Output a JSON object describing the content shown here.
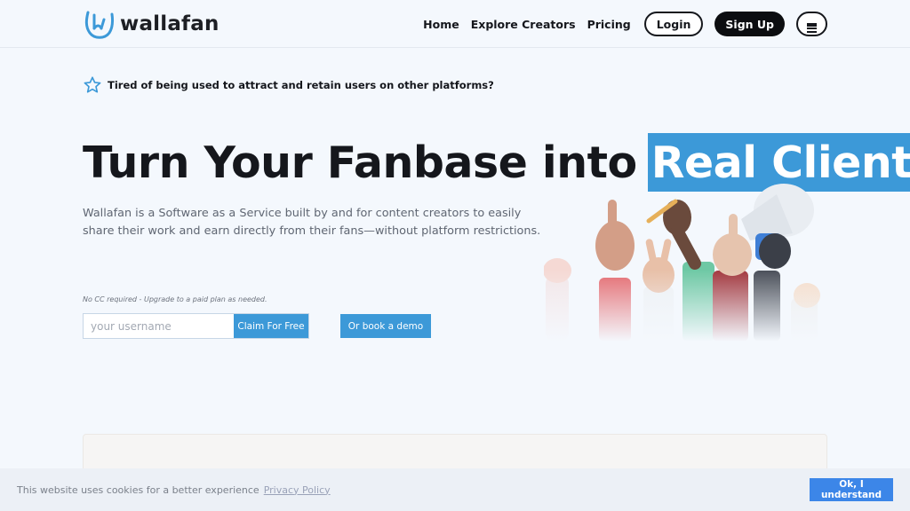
{
  "brand": {
    "name": "wallafan",
    "logo_icon": "hand-logo-icon",
    "accent": "#3c99d8"
  },
  "nav": {
    "links": [
      "Home",
      "Explore Creators",
      "Pricing"
    ],
    "login_label": "Login",
    "signup_label": "Sign Up",
    "menu_icon": "hamburger-icon"
  },
  "hero": {
    "tagline_icon": "star-icon",
    "tagline": "Tired of being used to attract and retain users on other platforms?",
    "headline_main": "Turn Your Fanbase into",
    "headline_highlight": "Real Clients",
    "description": "Wallafan is a Software as a Service built by and for content creators to easily share their work and earn directly from their fans—without platform restrictions.",
    "note": "No CC required - Upgrade to a paid plan as needed.",
    "username_placeholder": "your username",
    "claim_label": "Claim For Free",
    "demo_label": "Or book a demo"
  },
  "cookie": {
    "text": "This website uses cookies for a better experience",
    "link": "Privacy Policy",
    "accept_label": "Ok, I understand",
    "button_color": "#3c86e8"
  }
}
